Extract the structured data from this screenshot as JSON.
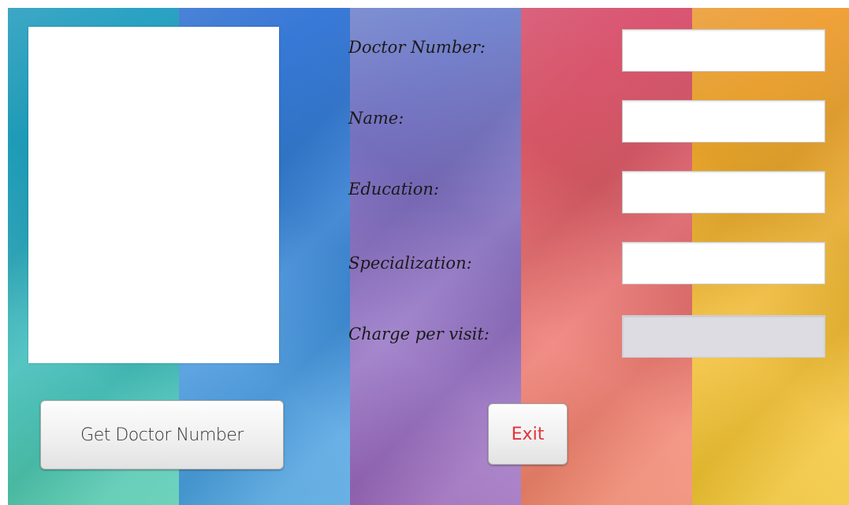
{
  "form": {
    "photo_box": "",
    "get_doctor_number_button": "Get Doctor Number",
    "exit_button": "Exit",
    "fields": [
      {
        "label": "Doctor Number:",
        "value": "",
        "enabled": true
      },
      {
        "label": "Name:",
        "value": "",
        "enabled": true
      },
      {
        "label": "Education:",
        "value": "",
        "enabled": true
      },
      {
        "label": "Specialization:",
        "value": "",
        "enabled": true
      },
      {
        "label": "Charge per visit:",
        "value": "",
        "enabled": false
      }
    ]
  },
  "colors": {
    "stripes": [
      "#23a9c2",
      "#3688dc",
      "#8b6fc6",
      "#ea6a6c",
      "#f3b72d"
    ],
    "exit_text": "#e0333b",
    "disabled_field": "#dcdce2"
  }
}
